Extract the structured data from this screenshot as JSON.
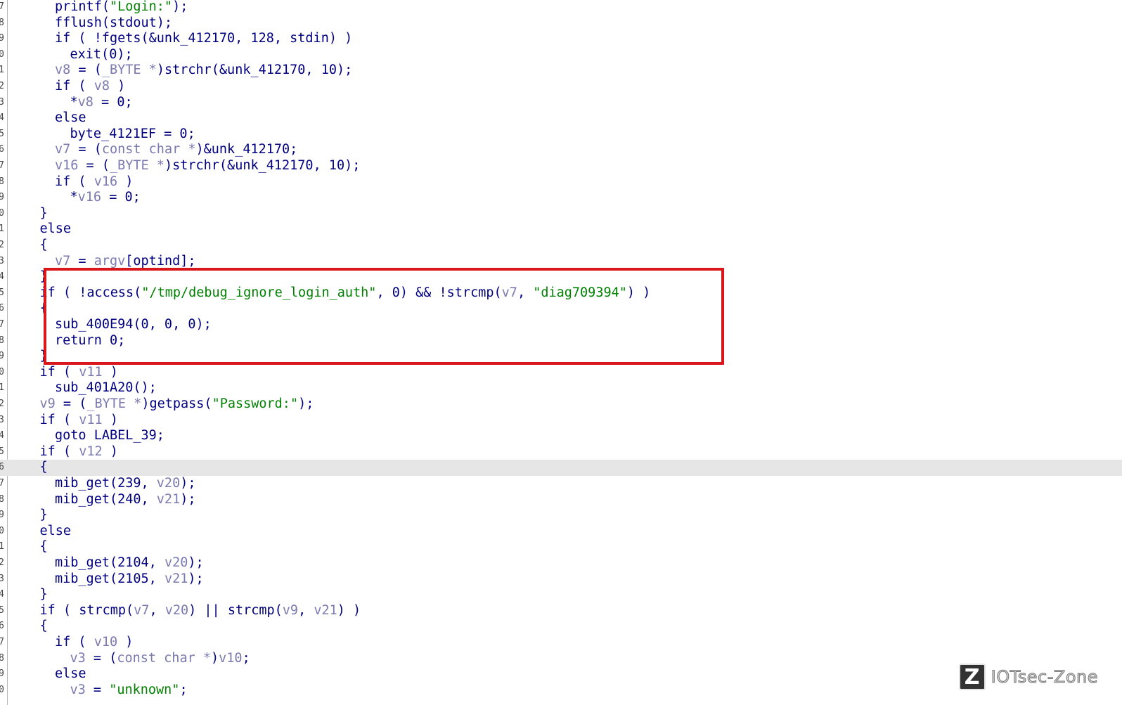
{
  "code": {
    "lines": [
      {
        "ln": "7",
        "indent": 4,
        "tokens": [
          [
            "k",
            "printf("
          ],
          [
            "s",
            "\"Login:\""
          ],
          [
            "k",
            ");"
          ]
        ]
      },
      {
        "ln": "8",
        "indent": 4,
        "tokens": [
          [
            "k",
            "fflush(stdout);"
          ]
        ]
      },
      {
        "ln": "9",
        "indent": 4,
        "tokens": [
          [
            "k",
            "if ( !fgets(&unk_412170, 128, stdin) )"
          ]
        ]
      },
      {
        "ln": "0",
        "indent": 6,
        "tokens": [
          [
            "k",
            "exit(0);"
          ]
        ]
      },
      {
        "ln": "1",
        "indent": 4,
        "tokens": [
          [
            "v",
            "v8"
          ],
          [
            "k",
            " = ("
          ],
          [
            "v",
            "_BYTE *"
          ],
          [
            "k",
            ")strchr(&unk_412170, 10);"
          ]
        ]
      },
      {
        "ln": "2",
        "indent": 4,
        "tokens": [
          [
            "k",
            "if ( "
          ],
          [
            "v",
            "v8"
          ],
          [
            "k",
            " )"
          ]
        ]
      },
      {
        "ln": "3",
        "indent": 6,
        "tokens": [
          [
            "k",
            "*"
          ],
          [
            "v",
            "v8"
          ],
          [
            "k",
            " = 0;"
          ]
        ]
      },
      {
        "ln": "4",
        "indent": 4,
        "tokens": [
          [
            "k",
            "else"
          ]
        ]
      },
      {
        "ln": "5",
        "indent": 6,
        "tokens": [
          [
            "k",
            "byte_4121EF = 0;"
          ]
        ]
      },
      {
        "ln": "6",
        "indent": 4,
        "tokens": [
          [
            "v",
            "v7"
          ],
          [
            "k",
            " = ("
          ],
          [
            "v",
            "const char *"
          ],
          [
            "k",
            ")&unk_412170;"
          ]
        ]
      },
      {
        "ln": "7",
        "indent": 4,
        "tokens": [
          [
            "v",
            "v16"
          ],
          [
            "k",
            " = ("
          ],
          [
            "v",
            "_BYTE *"
          ],
          [
            "k",
            ")strchr(&unk_412170, 10);"
          ]
        ]
      },
      {
        "ln": "8",
        "indent": 4,
        "tokens": [
          [
            "k",
            "if ( "
          ],
          [
            "v",
            "v16"
          ],
          [
            "k",
            " )"
          ]
        ]
      },
      {
        "ln": "9",
        "indent": 6,
        "tokens": [
          [
            "k",
            "*"
          ],
          [
            "v",
            "v16"
          ],
          [
            "k",
            " = 0;"
          ]
        ]
      },
      {
        "ln": "0",
        "indent": 2,
        "tokens": [
          [
            "k",
            "}"
          ]
        ]
      },
      {
        "ln": "1",
        "indent": 2,
        "tokens": [
          [
            "k",
            "else"
          ]
        ]
      },
      {
        "ln": "2",
        "indent": 2,
        "tokens": [
          [
            "k",
            "{"
          ]
        ]
      },
      {
        "ln": "3",
        "indent": 4,
        "tokens": [
          [
            "v",
            "v7"
          ],
          [
            "k",
            " = "
          ],
          [
            "v",
            "argv"
          ],
          [
            "k",
            "[optind];"
          ]
        ]
      },
      {
        "ln": "4",
        "indent": 2,
        "tokens": [
          [
            "k",
            "}"
          ]
        ]
      },
      {
        "ln": "5",
        "indent": 2,
        "tokens": [
          [
            "k",
            "if ( !access("
          ],
          [
            "s",
            "\"/tmp/debug_ignore_login_auth\""
          ],
          [
            "k",
            ", 0) && !strcmp("
          ],
          [
            "v",
            "v7"
          ],
          [
            "k",
            ", "
          ],
          [
            "s",
            "\"diag709394\""
          ],
          [
            "k",
            ") )"
          ]
        ]
      },
      {
        "ln": "6",
        "indent": 2,
        "tokens": [
          [
            "k",
            "{"
          ]
        ]
      },
      {
        "ln": "7",
        "indent": 4,
        "tokens": [
          [
            "k",
            "sub_400E94(0, 0, 0);"
          ]
        ]
      },
      {
        "ln": "8",
        "indent": 4,
        "tokens": [
          [
            "k",
            "return 0;"
          ]
        ]
      },
      {
        "ln": "9",
        "indent": 2,
        "tokens": [
          [
            "k",
            "}"
          ]
        ]
      },
      {
        "ln": "0",
        "indent": 2,
        "tokens": [
          [
            "k",
            "if ( "
          ],
          [
            "v",
            "v11"
          ],
          [
            "k",
            " )"
          ]
        ]
      },
      {
        "ln": "1",
        "indent": 4,
        "tokens": [
          [
            "k",
            "sub_401A20();"
          ]
        ]
      },
      {
        "ln": "2",
        "indent": 2,
        "tokens": [
          [
            "v",
            "v9"
          ],
          [
            "k",
            " = ("
          ],
          [
            "v",
            "_BYTE *"
          ],
          [
            "k",
            ")getpass("
          ],
          [
            "s",
            "\"Password:\""
          ],
          [
            "k",
            ");"
          ]
        ]
      },
      {
        "ln": "3",
        "indent": 2,
        "tokens": [
          [
            "k",
            "if ( "
          ],
          [
            "v",
            "v11"
          ],
          [
            "k",
            " )"
          ]
        ]
      },
      {
        "ln": "4",
        "indent": 4,
        "tokens": [
          [
            "k",
            "goto LABEL_39;"
          ]
        ]
      },
      {
        "ln": "5",
        "indent": 2,
        "tokens": [
          [
            "k",
            "if ( "
          ],
          [
            "v",
            "v12"
          ],
          [
            "k",
            " )"
          ]
        ]
      },
      {
        "ln": "6",
        "indent": 2,
        "tokens": [
          [
            "k",
            "{"
          ]
        ],
        "highlight": true
      },
      {
        "ln": "7",
        "indent": 4,
        "tokens": [
          [
            "k",
            "mib_get(239, "
          ],
          [
            "v",
            "v20"
          ],
          [
            "k",
            ");"
          ]
        ]
      },
      {
        "ln": "8",
        "indent": 4,
        "tokens": [
          [
            "k",
            "mib_get(240, "
          ],
          [
            "v",
            "v21"
          ],
          [
            "k",
            ");"
          ]
        ]
      },
      {
        "ln": "9",
        "indent": 2,
        "tokens": [
          [
            "k",
            "}"
          ]
        ]
      },
      {
        "ln": "0",
        "indent": 2,
        "tokens": [
          [
            "k",
            "else"
          ]
        ]
      },
      {
        "ln": "1",
        "indent": 2,
        "tokens": [
          [
            "k",
            "{"
          ]
        ]
      },
      {
        "ln": "2",
        "indent": 4,
        "tokens": [
          [
            "k",
            "mib_get(2104, "
          ],
          [
            "v",
            "v20"
          ],
          [
            "k",
            ");"
          ]
        ]
      },
      {
        "ln": "3",
        "indent": 4,
        "tokens": [
          [
            "k",
            "mib_get(2105, "
          ],
          [
            "v",
            "v21"
          ],
          [
            "k",
            ");"
          ]
        ]
      },
      {
        "ln": "4",
        "indent": 2,
        "tokens": [
          [
            "k",
            "}"
          ]
        ]
      },
      {
        "ln": "5",
        "indent": 2,
        "tokens": [
          [
            "k",
            "if ( strcmp("
          ],
          [
            "v",
            "v7"
          ],
          [
            "k",
            ", "
          ],
          [
            "v",
            "v20"
          ],
          [
            "k",
            ") || strcmp("
          ],
          [
            "v",
            "v9"
          ],
          [
            "k",
            ", "
          ],
          [
            "v",
            "v21"
          ],
          [
            "k",
            ") )"
          ]
        ]
      },
      {
        "ln": "6",
        "indent": 2,
        "tokens": [
          [
            "k",
            "{"
          ]
        ]
      },
      {
        "ln": "7",
        "indent": 4,
        "tokens": [
          [
            "k",
            "if ( "
          ],
          [
            "v",
            "v10"
          ],
          [
            "k",
            " )"
          ]
        ]
      },
      {
        "ln": "8",
        "indent": 6,
        "tokens": [
          [
            "v",
            "v3"
          ],
          [
            "k",
            " = ("
          ],
          [
            "v",
            "const char *"
          ],
          [
            "k",
            ")"
          ],
          [
            "v",
            "v10"
          ],
          [
            "k",
            ";"
          ]
        ]
      },
      {
        "ln": "9",
        "indent": 4,
        "tokens": [
          [
            "k",
            "else"
          ]
        ]
      },
      {
        "ln": "0",
        "indent": 6,
        "tokens": [
          [
            "v",
            "v3"
          ],
          [
            "k",
            " = "
          ],
          [
            "s",
            "\"unknown\""
          ],
          [
            "k",
            ";"
          ]
        ]
      }
    ]
  },
  "colors": {
    "keyword": "#000080",
    "variable": "#7a7ab0",
    "string": "#008000",
    "highlight_box": "#d9161c",
    "line_highlight": "#e6e6e6"
  },
  "watermark": {
    "logo": "Z",
    "text": "IOTsec-Zone"
  }
}
